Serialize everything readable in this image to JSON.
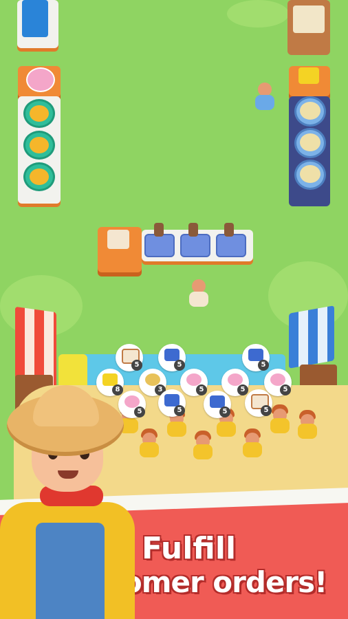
{
  "banner": {
    "line1": "Fulfill",
    "line2": "customer orders!"
  },
  "colors": {
    "grass": "#8fd462",
    "banner": "#f05b55",
    "text": "#ffffff"
  },
  "orders": [
    {
      "item": "pie-icon",
      "count": "5"
    },
    {
      "item": "shirt-icon",
      "count": "5"
    },
    {
      "item": "shirt-icon",
      "count": "5"
    },
    {
      "item": "cheese-icon",
      "count": "8"
    },
    {
      "item": "pastry-icon",
      "count": "3"
    },
    {
      "item": "cake-icon",
      "count": "5"
    },
    {
      "item": "cake-icon",
      "count": "5"
    },
    {
      "item": "cake-icon",
      "count": "5"
    },
    {
      "item": "cake-icon",
      "count": "5"
    },
    {
      "item": "shirt-icon",
      "count": "5"
    },
    {
      "item": "shirt-icon",
      "count": "5"
    },
    {
      "item": "pie-icon",
      "count": "5"
    }
  ]
}
